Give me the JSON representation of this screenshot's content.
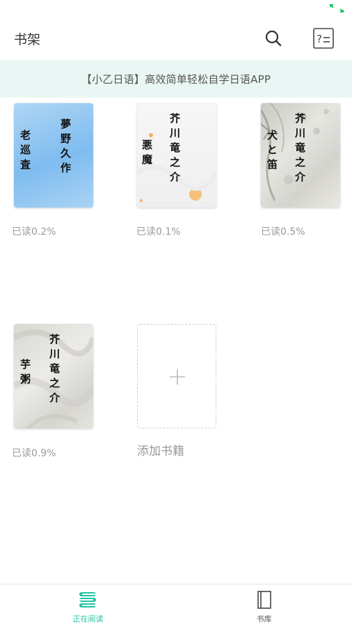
{
  "header": {
    "title": "书架"
  },
  "banner": {
    "text": "【小乙日语】高效简单轻松自学日语APP"
  },
  "books": [
    {
      "title": "老巡査",
      "author": "夢野久作",
      "progress": "已读0.2%"
    },
    {
      "title": "悪魔",
      "author": "芥川竜之介",
      "progress": "已读0.1%"
    },
    {
      "title": "犬と笛",
      "author": "芥川竜之介",
      "progress": "已读0.5%"
    },
    {
      "title": "芋粥",
      "author": "芥川竜之介",
      "progress": "已读0.9%"
    }
  ],
  "add_book": {
    "label": "添加书籍"
  },
  "tabs": [
    {
      "label": "正在阅读",
      "icon": "reading-icon",
      "active": true
    },
    {
      "label": "书库",
      "icon": "library-icon",
      "active": false
    }
  ],
  "colors": {
    "accent": "#22c4a3",
    "banner_bg": "#eaf6f3"
  }
}
